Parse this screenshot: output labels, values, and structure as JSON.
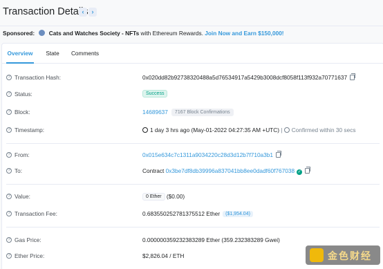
{
  "header": {
    "title": "Transaction Details",
    "prev_label": "‹",
    "next_label": "›"
  },
  "sponsor": {
    "label": "Sponsored:",
    "brand": "Cats and Watches Society - NFTs",
    "middle": " with Ethereum Rewards. ",
    "cta": "Join Now and Earn $150,000!"
  },
  "tabs": [
    "Overview",
    "State",
    "Comments"
  ],
  "rows": {
    "hash": {
      "label": "Transaction Hash:",
      "value": "0x020dd82b92738320488a5d76534917a5429b3008dcf8058f113f932a70771637"
    },
    "status": {
      "label": "Status:",
      "value": "Success"
    },
    "block": {
      "label": "Block:",
      "value": "14689637",
      "confirmations": "7167 Block Confirmations"
    },
    "timestamp": {
      "label": "Timestamp:",
      "value": "1 day 3 hrs ago (May-01-2022 04:27:35 AM +UTC)",
      "confirmed": "Confirmed within 30 secs",
      "sep": "|"
    },
    "from": {
      "label": "From:",
      "value": "0x015e634c7c1311a9034220c28d3d12b7f710a3b1"
    },
    "to": {
      "label": "To:",
      "prefix": "Contract",
      "value": "0x3be7df8db39996a837041bb8ee0dadf60f767038"
    },
    "value": {
      "label": "Value:",
      "badge": "0 Ether",
      "usd": "($0.00)"
    },
    "fee": {
      "label": "Transaction Fee:",
      "value": "0.683550252781375512 Ether",
      "usd": "($1,954.04)"
    },
    "gas": {
      "label": "Gas Price:",
      "value": "0.000000359232383289 Ether (359.232383289 Gwei)"
    },
    "ether_price": {
      "label": "Ether Price:",
      "value": "$2,826.04 / ETH"
    }
  },
  "watermark": {
    "text": "金色财经"
  },
  "colors": {
    "accent": "#3498db",
    "success": "#00a186"
  }
}
